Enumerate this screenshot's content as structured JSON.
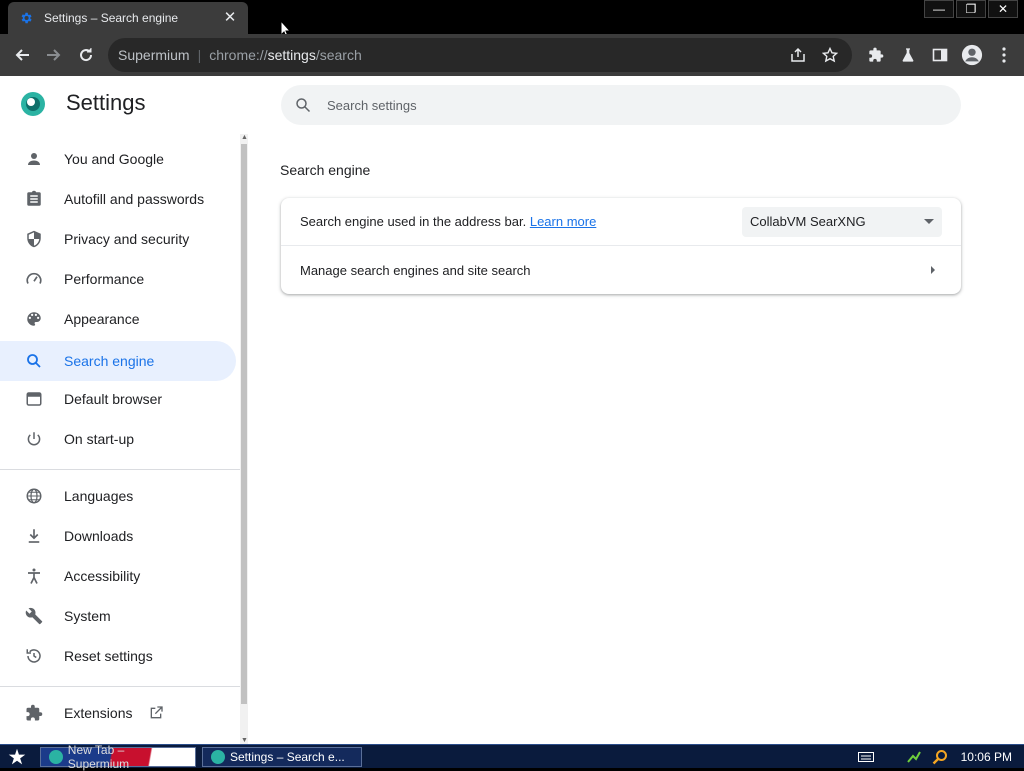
{
  "browser": {
    "tab_title": "Settings – Search engine",
    "omnibox_host": "Supermium",
    "url_scheme": "chrome://",
    "url_host_path": "settings",
    "url_rest": "/search"
  },
  "settings": {
    "title": "Settings",
    "search_placeholder": "Search settings",
    "nav": [
      {
        "label": "You and Google",
        "icon": "person-icon"
      },
      {
        "label": "Autofill and passwords",
        "icon": "clipboard-icon"
      },
      {
        "label": "Privacy and security",
        "icon": "shield-icon"
      },
      {
        "label": "Performance",
        "icon": "speedometer-icon"
      },
      {
        "label": "Appearance",
        "icon": "palette-icon"
      },
      {
        "label": "Search engine",
        "icon": "search-icon",
        "active": true
      },
      {
        "label": "Default browser",
        "icon": "browser-window-icon"
      },
      {
        "label": "On start-up",
        "icon": "power-icon"
      },
      {
        "label": "Languages",
        "icon": "globe-icon"
      },
      {
        "label": "Downloads",
        "icon": "download-icon"
      },
      {
        "label": "Accessibility",
        "icon": "accessibility-icon"
      },
      {
        "label": "System",
        "icon": "wrench-icon"
      },
      {
        "label": "Reset settings",
        "icon": "history-icon"
      },
      {
        "label": "Extensions",
        "icon": "puzzle-icon"
      }
    ],
    "section_title": "Search engine",
    "row1_label": "Search engine used in the address bar.",
    "row1_link": "Learn more",
    "row1_value": "CollabVM SearXNG",
    "row2_label": "Manage search engines and site search"
  },
  "taskbar": {
    "task1": "New Tab – Supermium",
    "task2": "Settings – Search e...",
    "clock": "10:06 PM"
  },
  "colors": {
    "accent": "#1a73e8",
    "active_bg": "#e8f0fe",
    "toolbar": "#3c3c3c"
  }
}
